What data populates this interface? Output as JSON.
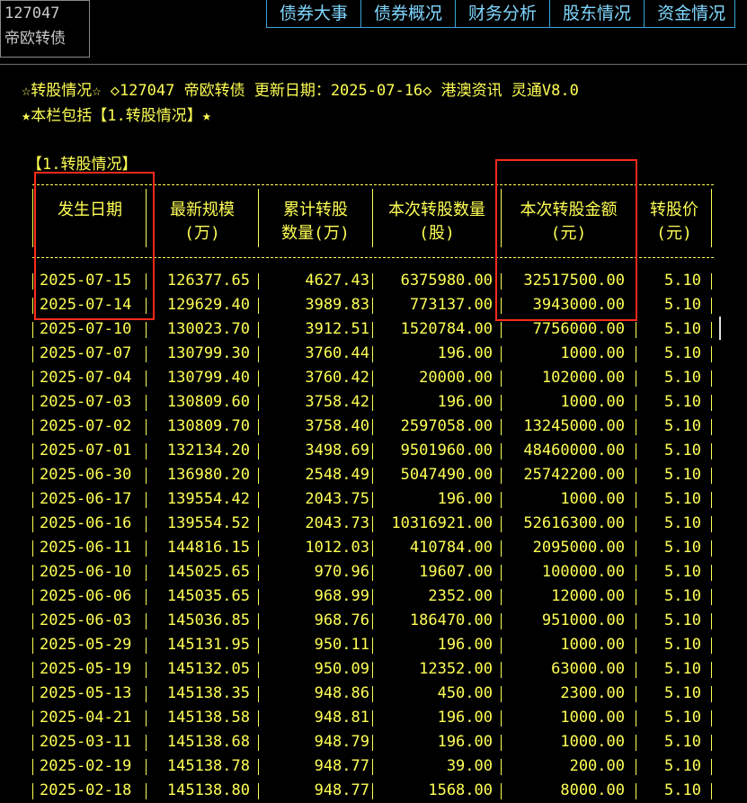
{
  "security": {
    "code": "127047",
    "name": "帝欧转债"
  },
  "tabs": [
    "债券大事",
    "债券概况",
    "财务分析",
    "股东情况",
    "资金情况"
  ],
  "info_line1": "☆转股情况☆ ◇127047 帝欧转债 更新日期：2025-07-16◇ 港澳资讯 灵通V8.0",
  "info_line2": "★本栏包括【1.转股情况】★",
  "section_title": "【1.转股情况】",
  "headers": [
    {
      "l1": "发生日期",
      "l2": ""
    },
    {
      "l1": "最新规模",
      "l2": "(万)"
    },
    {
      "l1": "累计转股",
      "l2": "数量(万)"
    },
    {
      "l1": "本次转股数量",
      "l2": "(股)"
    },
    {
      "l1": "本次转股金额",
      "l2": "(元)"
    },
    {
      "l1": "转股价",
      "l2": "(元)"
    }
  ],
  "rows": [
    [
      "2025-07-15",
      "126377.65",
      "4627.43",
      "6375980.00",
      "32517500.00",
      "5.10"
    ],
    [
      "2025-07-14",
      "129629.40",
      "3989.83",
      "773137.00",
      "3943000.00",
      "5.10"
    ],
    [
      "2025-07-10",
      "130023.70",
      "3912.51",
      "1520784.00",
      "7756000.00",
      "5.10"
    ],
    [
      "2025-07-07",
      "130799.30",
      "3760.44",
      "196.00",
      "1000.00",
      "5.10"
    ],
    [
      "2025-07-04",
      "130799.40",
      "3760.42",
      "20000.00",
      "102000.00",
      "5.10"
    ],
    [
      "2025-07-03",
      "130809.60",
      "3758.42",
      "196.00",
      "1000.00",
      "5.10"
    ],
    [
      "2025-07-02",
      "130809.70",
      "3758.40",
      "2597058.00",
      "13245000.00",
      "5.10"
    ],
    [
      "2025-07-01",
      "132134.20",
      "3498.69",
      "9501960.00",
      "48460000.00",
      "5.10"
    ],
    [
      "2025-06-30",
      "136980.20",
      "2548.49",
      "5047490.00",
      "25742200.00",
      "5.10"
    ],
    [
      "2025-06-17",
      "139554.42",
      "2043.75",
      "196.00",
      "1000.00",
      "5.10"
    ],
    [
      "2025-06-16",
      "139554.52",
      "2043.73",
      "10316921.00",
      "52616300.00",
      "5.10"
    ],
    [
      "2025-06-11",
      "144816.15",
      "1012.03",
      "410784.00",
      "2095000.00",
      "5.10"
    ],
    [
      "2025-06-10",
      "145025.65",
      "970.96",
      "19607.00",
      "100000.00",
      "5.10"
    ],
    [
      "2025-06-06",
      "145035.65",
      "968.99",
      "2352.00",
      "12000.00",
      "5.10"
    ],
    [
      "2025-06-03",
      "145036.85",
      "968.76",
      "186470.00",
      "951000.00",
      "5.10"
    ],
    [
      "2025-05-29",
      "145131.95",
      "950.11",
      "196.00",
      "1000.00",
      "5.10"
    ],
    [
      "2025-05-19",
      "145132.05",
      "950.09",
      "12352.00",
      "63000.00",
      "5.10"
    ],
    [
      "2025-05-13",
      "145138.35",
      "948.86",
      "450.00",
      "2300.00",
      "5.10"
    ],
    [
      "2025-04-21",
      "145138.58",
      "948.81",
      "196.00",
      "1000.00",
      "5.10"
    ],
    [
      "2025-03-11",
      "145138.68",
      "948.79",
      "196.00",
      "1000.00",
      "5.10"
    ],
    [
      "2025-02-19",
      "145138.78",
      "948.77",
      "39.00",
      "200.00",
      "5.10"
    ],
    [
      "2025-02-18",
      "145138.80",
      "948.77",
      "1568.00",
      "8000.00",
      "5.10"
    ]
  ]
}
